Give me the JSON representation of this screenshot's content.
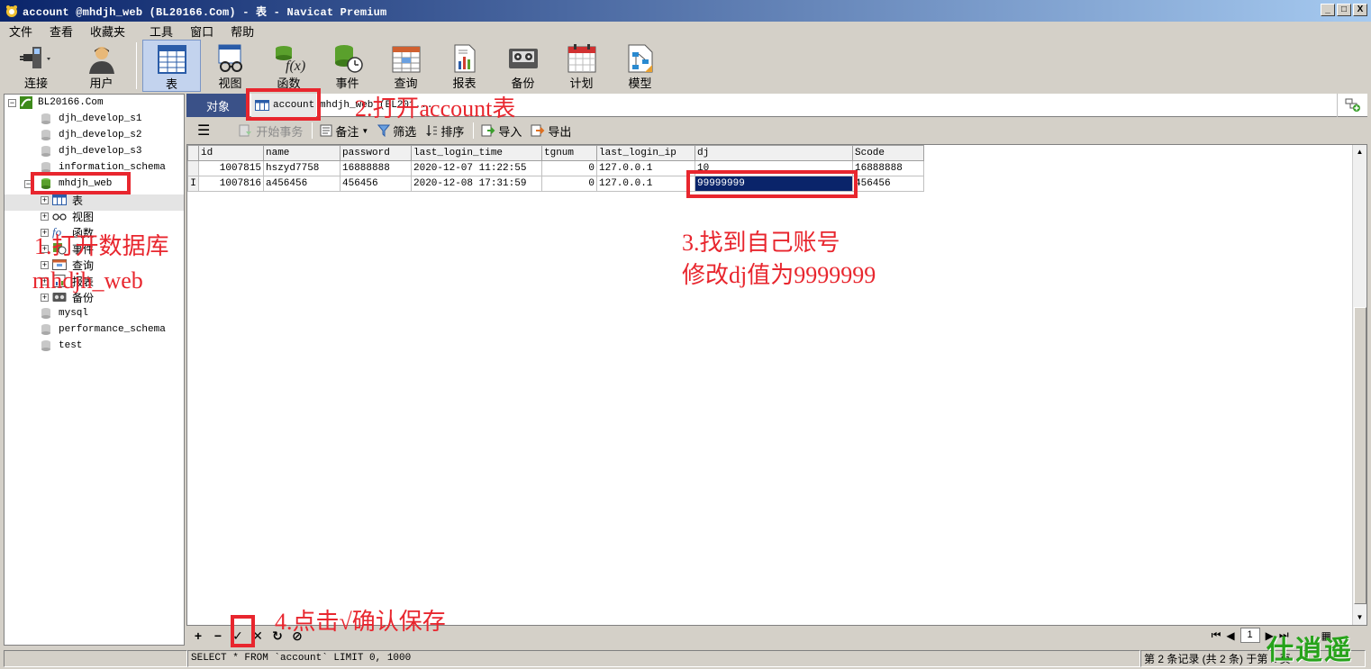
{
  "window": {
    "title": "account @mhdjh_web (BL20166.Com) - 表 - Navicat Premium",
    "btn_minimize": "_",
    "btn_restore": "□",
    "btn_close": "X"
  },
  "menu": [
    "文件",
    "查看",
    "收藏夹",
    "工具",
    "窗口",
    "帮助"
  ],
  "toolbar": {
    "items": [
      {
        "label": "连接",
        "icon": "plug-icon"
      },
      {
        "label": "用户",
        "icon": "user-icon"
      },
      {
        "label": "表",
        "icon": "table-icon",
        "active": true
      },
      {
        "label": "视图",
        "icon": "view-glasses-icon"
      },
      {
        "label": "函数",
        "icon": "function-icon"
      },
      {
        "label": "事件",
        "icon": "event-icon"
      },
      {
        "label": "查询",
        "icon": "query-icon"
      },
      {
        "label": "报表",
        "icon": "report-icon"
      },
      {
        "label": "备份",
        "icon": "backup-icon"
      },
      {
        "label": "计划",
        "icon": "calendar-icon"
      },
      {
        "label": "模型",
        "icon": "model-icon"
      }
    ]
  },
  "tree": {
    "connection": "BL20166.Com",
    "databases_before": [
      "djh_develop_s1",
      "djh_develop_s2",
      "djh_develop_s3",
      "information_schema"
    ],
    "open_db": "mhdjh_web",
    "children": [
      "表",
      "视图",
      "函数",
      "事件",
      "查询",
      "报表",
      "备份"
    ],
    "child_icons": [
      "table-icon",
      "view-glasses-icon",
      "function-icon",
      "event-icon",
      "query-icon",
      "report-icon",
      "backup-icon"
    ],
    "databases_after": [
      "mysql",
      "performance_schema",
      "test"
    ]
  },
  "tabs": {
    "objects": "对象",
    "account": "account",
    "db_path": "mhdjh_web (BL201..."
  },
  "subtoolbar": {
    "begin_transaction": "开始事务",
    "memo": "备注",
    "filter": "筛选",
    "sort": "排序",
    "import": "导入",
    "export": "导出"
  },
  "table": {
    "columns": [
      "id",
      "name",
      "password",
      "last_login_time",
      "tgnum",
      "last_login_ip",
      "dj",
      "Scode"
    ],
    "rows": [
      [
        "1007815",
        "hszyd7758",
        "16888888",
        "2020-12-07 11:22:55",
        "0",
        "127.0.0.1",
        "10",
        "16888888"
      ],
      [
        "1007816",
        "a456456",
        "456456",
        "2020-12-08 17:31:59",
        "0",
        "127.0.0.1",
        "99999999",
        "456456"
      ]
    ],
    "row_cursor_marker": "I"
  },
  "bottombar": {
    "buttons": [
      "+",
      "−",
      "✓",
      "✕",
      "↻",
      "⊘"
    ],
    "page": "1"
  },
  "status": {
    "sql": "SELECT * FROM `account` LIMIT 0, 1000",
    "records": "第 2 条记录 (共 2 条) 于第 1 页"
  },
  "annotations": {
    "step1_line1": "1.打开数据库",
    "step1_line2": "mhdjh_web",
    "step2": "2.打开account表",
    "step3_line1": "3.找到自己账号",
    "step3_line2": "修改dj值为9999999",
    "step4": "4.点击√确认保存",
    "watermark": "仕逍遥"
  },
  "colors": {
    "annotation_red": "#e8262e",
    "title_bar": "#0a246a",
    "active_tab": "#3a5188",
    "editing_cell": "#0a246a",
    "watermark_green": "#27a31b"
  }
}
